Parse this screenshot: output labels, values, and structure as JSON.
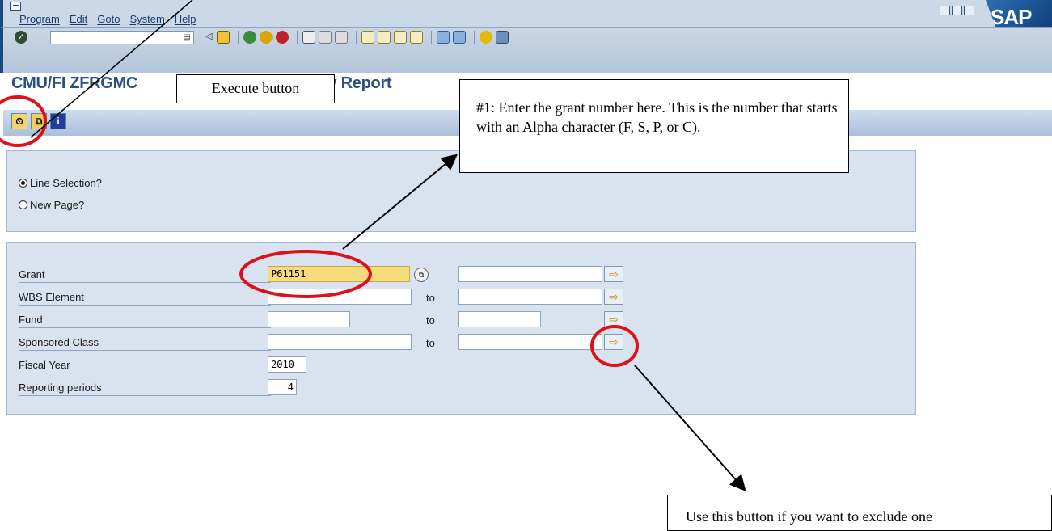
{
  "menu": {
    "items": [
      "Program",
      "Edit",
      "Goto",
      "System",
      "Help"
    ]
  },
  "logo": "SAP",
  "page_title": "CMU/FI ZFRGMC",
  "page_title_suffix": "ry Report",
  "selection": {
    "line_selection_label": "Line Selection?",
    "new_page_label": "New Page?"
  },
  "criteria": {
    "grant_label": "Grant",
    "grant_value": "P61151",
    "wbs_label": "WBS Element",
    "fund_label": "Fund",
    "sponsored_label": "Sponsored Class",
    "fiscal_year_label": "Fiscal Year",
    "fiscal_year_value": "2010",
    "reporting_periods_label": "Reporting periods",
    "reporting_periods_value": "4",
    "to_label": "to"
  },
  "callouts": {
    "execute": "Execute button",
    "grant_help": "#1: Enter the grant number here.  This is the number that starts with an Alpha character (F, S, P, or C).",
    "exclude_help": "Use this button if you want to exclude one"
  },
  "colors": {
    "highlight_field": "#f7dc7c",
    "annotation_red": "#e0101a",
    "title_blue": "#2b5183"
  }
}
